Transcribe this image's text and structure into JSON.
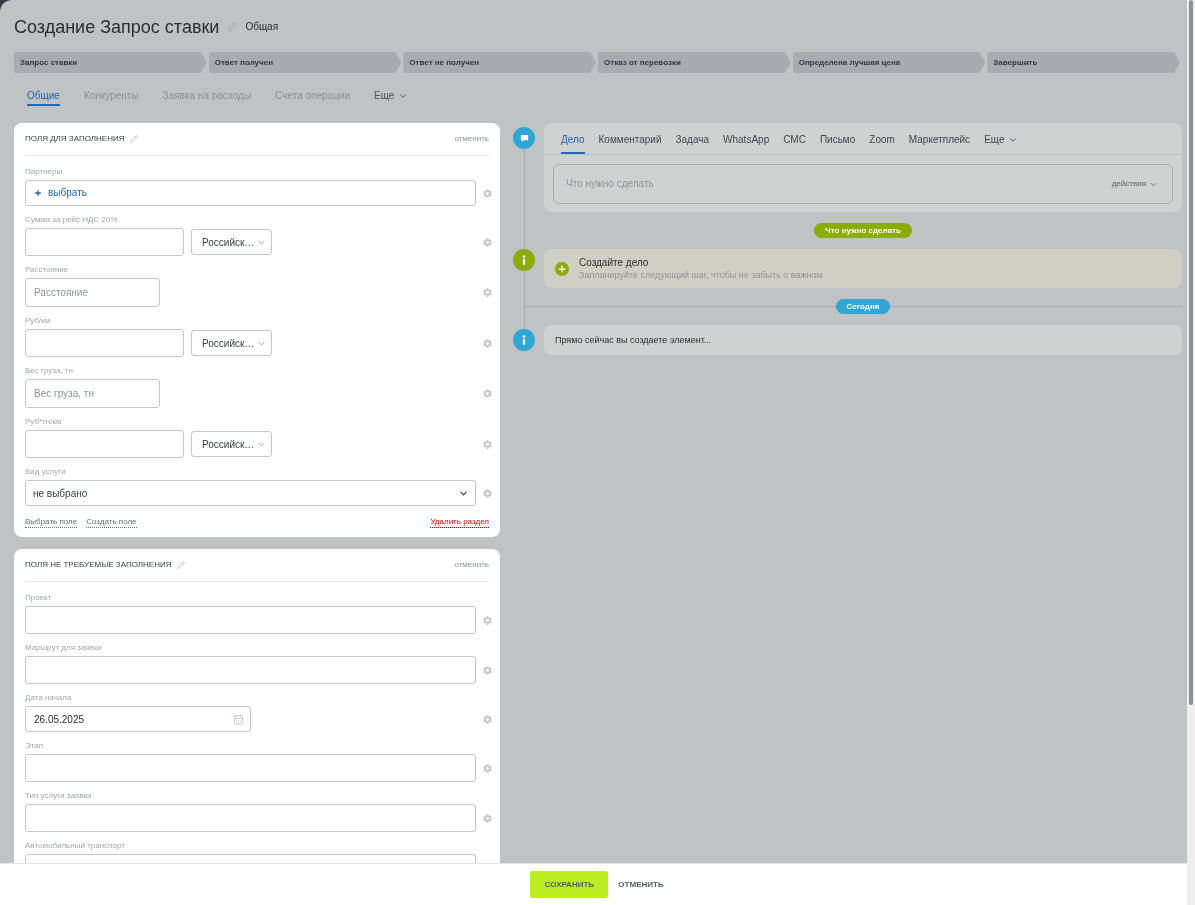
{
  "header": {
    "title": "Создание Запрос ставки",
    "category": "Общая"
  },
  "stages": [
    {
      "label": "Запрос ставки"
    },
    {
      "label": "Ответ получен"
    },
    {
      "label": "Ответ не получен"
    },
    {
      "label": "Отказ от перевозки"
    },
    {
      "label": "Определена лучшая цена"
    },
    {
      "label": "Завершить"
    }
  ],
  "tabs": [
    {
      "label": "Общие",
      "selected": true,
      "kind": "tab"
    },
    {
      "label": "Конкуренты",
      "selected": false,
      "kind": "tab"
    },
    {
      "label": "Заявка на расходы",
      "selected": false,
      "kind": "tab"
    },
    {
      "label": "Счета операции",
      "selected": false,
      "kind": "tab"
    },
    {
      "label": "Еще",
      "selected": false,
      "kind": "more"
    }
  ],
  "sections": [
    {
      "title": "ПОЛЯ ДЛЯ ЗАПОЛНЕНИЯ",
      "cancel": "отменить",
      "fields": [
        {
          "label": "Партнеры",
          "kind": "picker",
          "value": "выбрать"
        },
        {
          "label": "Сумма за рейс НДС 20%",
          "kind": "money",
          "currency": "Российск…"
        },
        {
          "label": "Расстояние",
          "kind": "short",
          "placeholder": "Расстояние"
        },
        {
          "label": "Руб/км",
          "kind": "money",
          "currency": "Российск…"
        },
        {
          "label": "Вес груза, тн",
          "kind": "short",
          "placeholder": "Вес груза, тн"
        },
        {
          "label": "Руб*тн/км",
          "kind": "money",
          "currency": "Российск…"
        },
        {
          "label": "Вид услуги",
          "kind": "select",
          "value": "не выбрано"
        }
      ],
      "links": [
        "Выбрать поле",
        "Создать поле"
      ],
      "delete": "Удалить раздел"
    },
    {
      "title": "ПОЛЯ НЕ ТРЕБУЕМЫЕ ЗАПОЛНЕНИЯ",
      "cancel": "отменить",
      "fields": [
        {
          "label": "Проект",
          "kind": "text"
        },
        {
          "label": "Маршрут для заявки",
          "kind": "text"
        },
        {
          "label": "Дата начала",
          "kind": "date",
          "value": "26.05.2025"
        },
        {
          "label": "Этап",
          "kind": "text"
        },
        {
          "label": "Тип услуги заявки",
          "kind": "text"
        },
        {
          "label": "Автомобильный транспорт",
          "kind": "text"
        }
      ]
    }
  ],
  "activity_editor": {
    "tabs": [
      {
        "label": "Дело",
        "selected": true,
        "kind": "tab"
      },
      {
        "label": "Комментарий",
        "selected": false,
        "kind": "tab"
      },
      {
        "label": "Задача",
        "selected": false,
        "kind": "tab"
      },
      {
        "label": "WhatsApp",
        "selected": false,
        "kind": "tab"
      },
      {
        "label": "СМС",
        "selected": false,
        "kind": "tab"
      },
      {
        "label": "Письмо",
        "selected": false,
        "kind": "tab"
      },
      {
        "label": "Zoom",
        "selected": false,
        "kind": "tab"
      },
      {
        "label": "Маркетплейс",
        "selected": false,
        "kind": "tab"
      },
      {
        "label": "Еще",
        "selected": false,
        "kind": "more"
      }
    ],
    "placeholder": "Что нужно сделать",
    "actions": "действия"
  },
  "timeline": [
    {
      "kind": "pill",
      "label": "Что нужно сделать",
      "color": "#8aad02"
    },
    {
      "kind": "hint",
      "title": "Создайте дело",
      "text": "Запланируйте следующий шаг, чтобы не забыть о важном",
      "color": "#8aab0a"
    },
    {
      "kind": "today",
      "label": "Сегодня",
      "color": "#2fa6d8"
    },
    {
      "kind": "note",
      "text": "Прямо сейчас вы создаете элемент...",
      "color": "#2fa6d8"
    }
  ],
  "footer": {
    "buttons": [
      {
        "label": "СОХРАНИТЬ",
        "kind": "primary"
      },
      {
        "label": "ОТМЕНИТЬ",
        "kind": "link"
      }
    ]
  }
}
